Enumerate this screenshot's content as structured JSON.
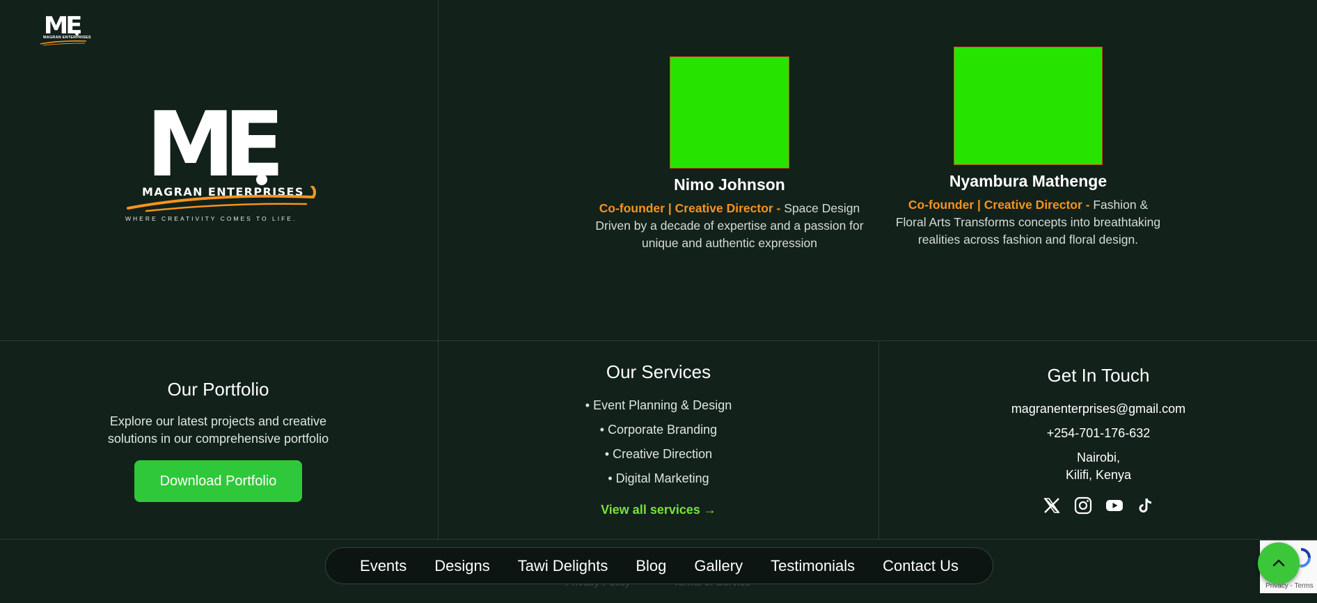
{
  "brand": {
    "monogram": "ME",
    "name": "MAGRAN ENTERPRISES",
    "tagline": "WHERE CREATIVITY COMES TO LIFE."
  },
  "team": [
    {
      "name": "Nimo Johnson",
      "role": "Co-founder | Creative Director -",
      "bio": "Space Design Driven by a decade of expertise and a passion for unique and authentic expression"
    },
    {
      "name": "Nyambura Mathenge",
      "role": "Co-founder | Creative Director -",
      "bio": "Fashion & Floral Arts Transforms concepts into breathtaking realities across fashion and floral design."
    }
  ],
  "portfolio": {
    "title": "Our Portfolio",
    "description": "Explore our latest projects and creative solutions in our comprehensive portfolio",
    "button": "Download Portfolio"
  },
  "services": {
    "title": "Our Services",
    "items": [
      "• Event Planning & Design",
      "• Corporate Branding",
      "• Creative Direction",
      "• Digital Marketing"
    ],
    "link": "View all services →"
  },
  "contact": {
    "title": "Get In Touch",
    "email": "magranenterprises@gmail.com",
    "phone": "+254-701-176-632",
    "location_line1": "Nairobi,",
    "location_line2": "Kilifi, Kenya",
    "socials": [
      "x-icon",
      "instagram-icon",
      "youtube-icon",
      "tiktok-icon"
    ]
  },
  "legal": {
    "privacy": "Privacy Policy",
    "separator": "•",
    "terms": "Terms of Service"
  },
  "nav": [
    "Events",
    "Designs",
    "Tawi Delights",
    "Blog",
    "Gallery",
    "Testimonials",
    "Contact Us"
  ],
  "recaptcha": {
    "text": "Privacy - Terms"
  },
  "colors": {
    "background": "#12211a",
    "accent_orange": "#f7931e",
    "accent_green": "#2fc83a",
    "link_green": "#7ce03a",
    "photo_placeholder": "#27e400"
  }
}
